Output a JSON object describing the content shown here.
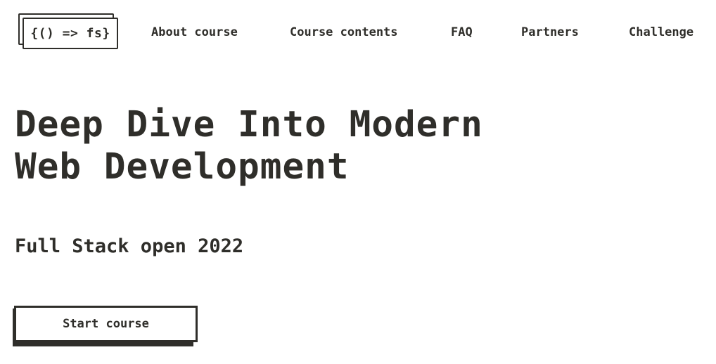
{
  "header": {
    "logo_text": "{() => fs}",
    "nav": [
      {
        "label": "About course"
      },
      {
        "label": "Course contents"
      },
      {
        "label": "FAQ"
      },
      {
        "label": "Partners"
      },
      {
        "label": "Challenge"
      }
    ]
  },
  "hero": {
    "title_line1": "Deep Dive Into Modern",
    "title_line2": "Web Development",
    "subtitle": "Full Stack open 2022",
    "cta_label": "Start course"
  },
  "colors": {
    "text": "#2f2e2a",
    "background": "#ffffff"
  }
}
